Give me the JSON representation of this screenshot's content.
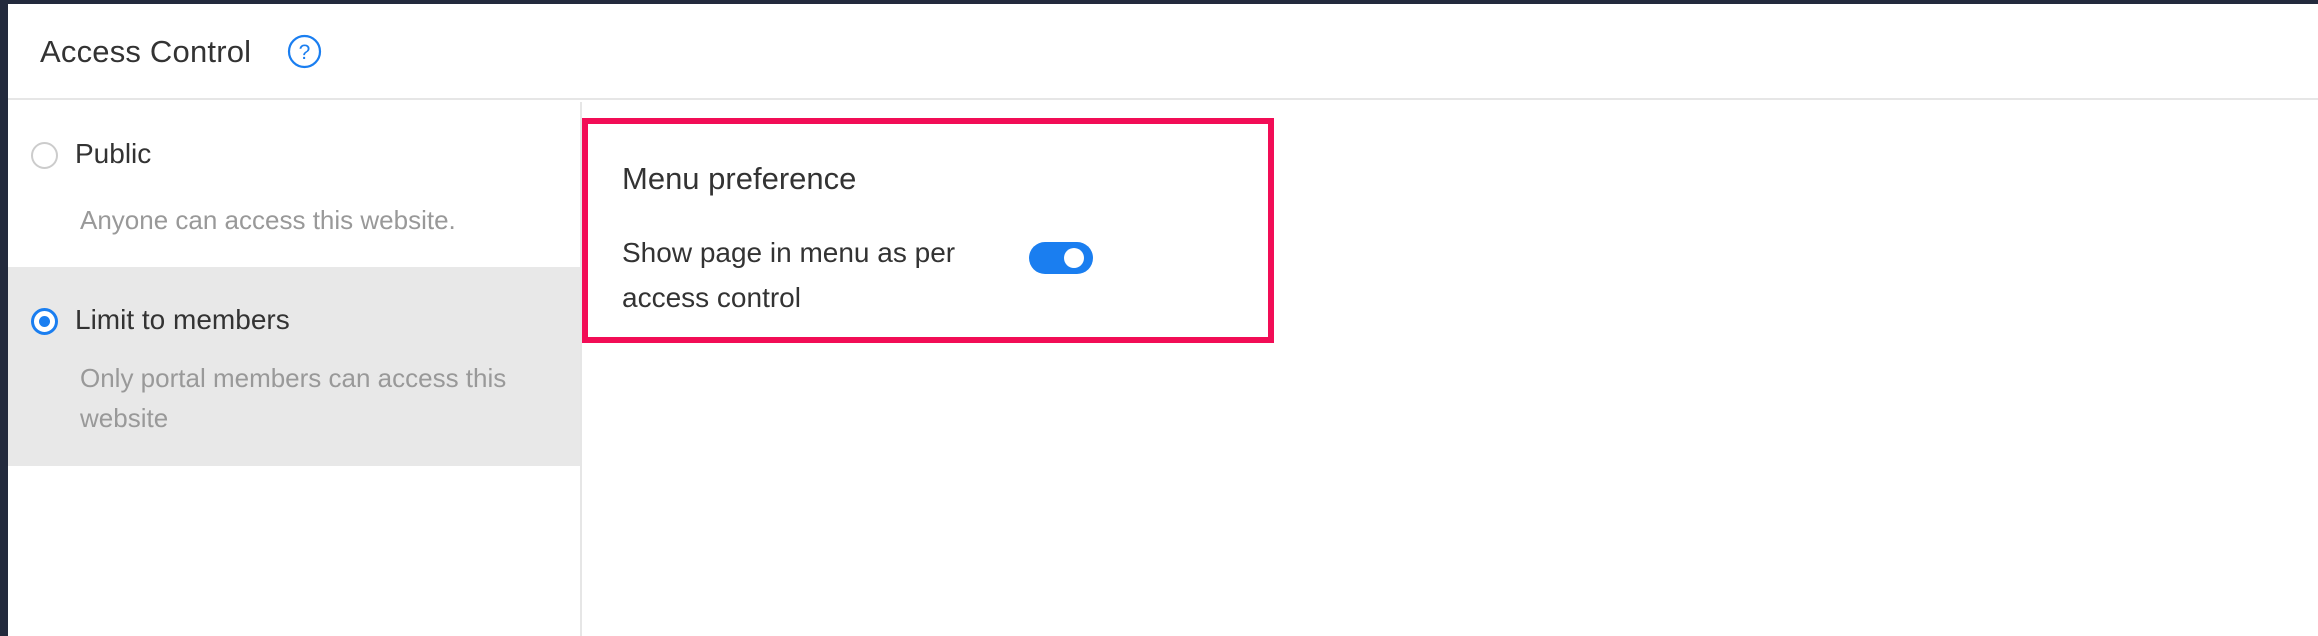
{
  "header": {
    "title": "Access Control",
    "help_icon": "question-circle-icon",
    "help_glyph": "?"
  },
  "access_options": [
    {
      "label": "Public",
      "description": "Anyone can access this website.",
      "selected": false
    },
    {
      "label": "Limit to members",
      "description": "Only portal members can access this website",
      "selected": true
    }
  ],
  "menu_preference": {
    "title": "Menu preference",
    "toggle_label": "Show page in menu as per access control",
    "toggle_on": true
  },
  "colors": {
    "accent": "#1a7ef0",
    "highlight": "#f20d56",
    "selected_bg": "#e8e8e8",
    "text": "#333333",
    "muted_text": "#999999"
  }
}
